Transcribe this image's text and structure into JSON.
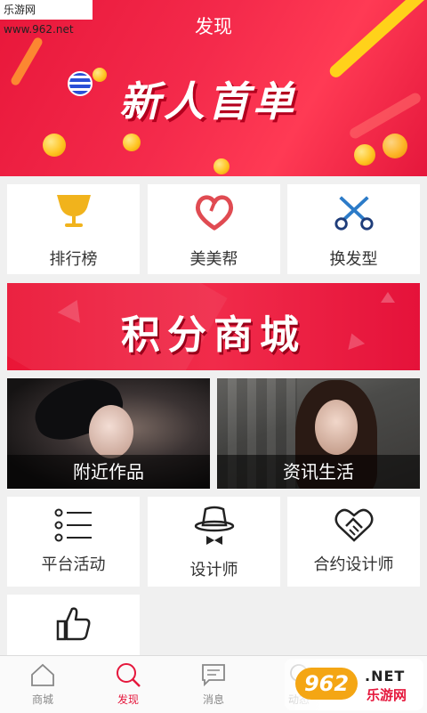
{
  "watermark_top": "乐游网 www.962.net",
  "page_title": "发现",
  "hero_banner": {
    "text": "新人首单"
  },
  "grid_top": [
    {
      "label": "排行榜",
      "icon": "trophy-icon"
    },
    {
      "label": "美美帮",
      "icon": "heart-icon"
    },
    {
      "label": "换发型",
      "icon": "scissors-icon"
    }
  ],
  "points_banner": {
    "text": "积分商城"
  },
  "photo_tiles": [
    {
      "caption": "附近作品"
    },
    {
      "caption": "资讯生活"
    }
  ],
  "grid_bottom": [
    {
      "label": "平台活动",
      "icon": "list-icon"
    },
    {
      "label": "设计师",
      "icon": "hat-tie-icon"
    },
    {
      "label": "合约设计师",
      "icon": "handshake-icon"
    }
  ],
  "extra_tile": {
    "icon": "thumbs-up-icon"
  },
  "tabbar": [
    {
      "label": "商城",
      "icon": "home-icon"
    },
    {
      "label": "发现",
      "icon": "search-icon",
      "active": true
    },
    {
      "label": "消息",
      "icon": "message-icon"
    },
    {
      "label": "动态",
      "icon": "activity-icon"
    }
  ],
  "watermark_bottom": {
    "badge": "962",
    "line1": ".NET",
    "line2": "乐游网"
  },
  "colors": {
    "accent": "#e5173c",
    "gold": "#f1b31c",
    "blue": "#2c7bc8"
  }
}
